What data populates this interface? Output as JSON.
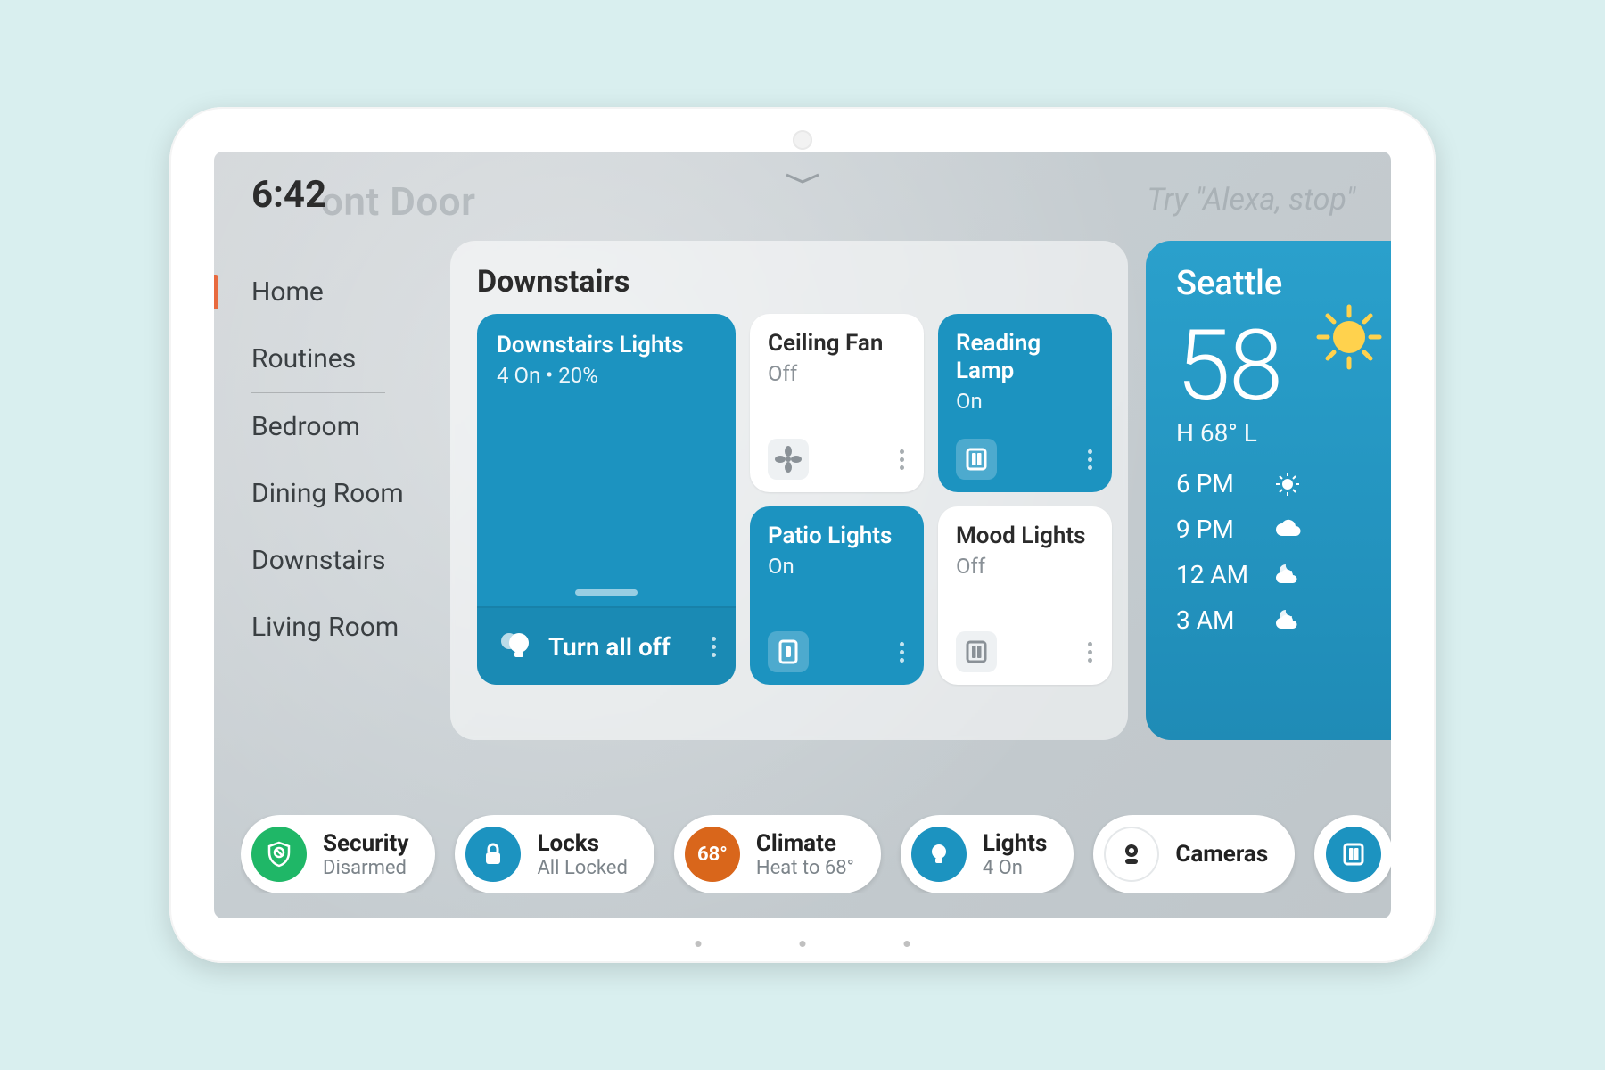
{
  "colors": {
    "accent_teal": "#1c93c0",
    "accent_teal_dark": "#1a8ab4",
    "chip_green": "#1fb767",
    "chip_orange": "#d9661b"
  },
  "background": {
    "faded_title": "ont Door",
    "faded_hint": "Try \"Alexa, stop\""
  },
  "header": {
    "clock": "6:42"
  },
  "sidebar": {
    "items": [
      {
        "label": "Home",
        "active": true
      },
      {
        "label": "Routines"
      },
      {
        "label": "Bedroom"
      },
      {
        "label": "Dining Room"
      },
      {
        "label": "Downstairs"
      },
      {
        "label": "Living Room"
      }
    ]
  },
  "panel": {
    "title": "Downstairs",
    "main_tile": {
      "title": "Downstairs Lights",
      "subtitle": "4 On • 20%",
      "action_label": "Turn all off"
    },
    "tiles": [
      {
        "title": "Ceiling Fan",
        "state_label": "Off",
        "on": false,
        "icon": "fan"
      },
      {
        "title": "Reading Lamp",
        "state_label": "On",
        "on": true,
        "icon": "switch"
      },
      {
        "title": "Patio Lights",
        "state_label": "On",
        "on": true,
        "icon": "outlet"
      },
      {
        "title": "Mood Lights",
        "state_label": "Off",
        "on": false,
        "icon": "switch"
      }
    ]
  },
  "weather": {
    "city": "Seattle",
    "temp": "58",
    "hilo": "H 68°   L",
    "forecast": [
      {
        "time": "6 PM",
        "icon": "sun"
      },
      {
        "time": "9 PM",
        "icon": "cloud"
      },
      {
        "time": "12 AM",
        "icon": "cloud-night"
      },
      {
        "time": "3 AM",
        "icon": "cloud-night"
      }
    ]
  },
  "chips": [
    {
      "icon": "shield",
      "color": "c-green",
      "title": "Security",
      "subtitle": "Disarmed"
    },
    {
      "icon": "lock",
      "color": "c-blue",
      "title": "Locks",
      "subtitle": "All Locked"
    },
    {
      "icon": "temp",
      "color": "c-orange",
      "title": "Climate",
      "subtitle": "Heat to 68°",
      "badge": "68°"
    },
    {
      "icon": "bulb",
      "color": "c-blue",
      "title": "Lights",
      "subtitle": "4 On"
    },
    {
      "icon": "camera",
      "color": "c-dark",
      "title": "Cameras",
      "subtitle": ""
    },
    {
      "icon": "switch",
      "color": "c-blue",
      "title": "",
      "subtitle": "",
      "round": true
    }
  ]
}
